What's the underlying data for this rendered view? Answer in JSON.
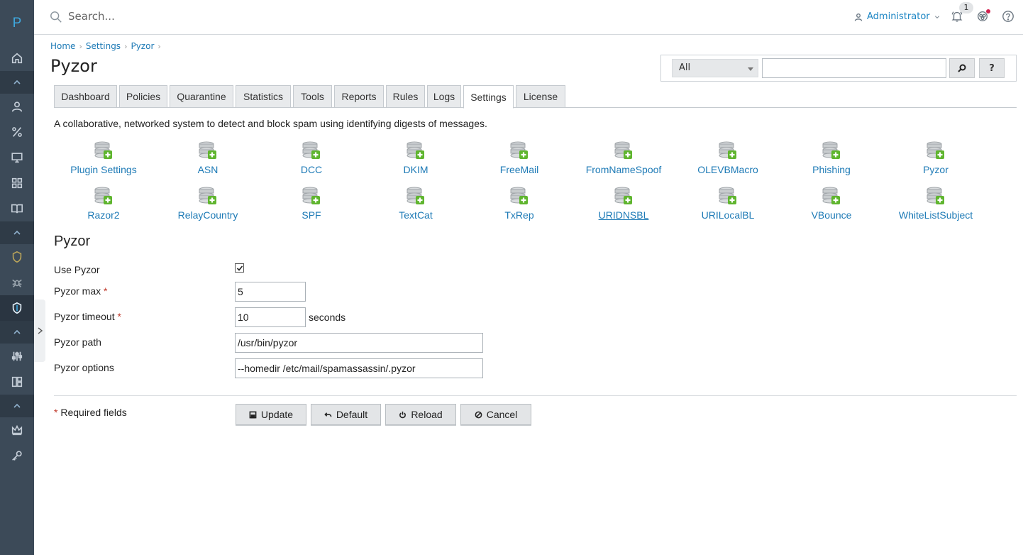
{
  "app": {
    "logo_letter": "P"
  },
  "topbar": {
    "search_placeholder": "Search...",
    "user_name": "Administrator",
    "notification_count": "1"
  },
  "breadcrumb": [
    "Home",
    "Settings",
    "Pyzor"
  ],
  "page_title": "Pyzor",
  "filter": {
    "select_value": "All",
    "search_value": "",
    "help_label": "?"
  },
  "tabs": [
    "Dashboard",
    "Policies",
    "Quarantine",
    "Statistics",
    "Tools",
    "Reports",
    "Rules",
    "Logs",
    "Settings",
    "License"
  ],
  "active_tab": "Settings",
  "description": "A collaborative, networked system to detect and block spam using identifying digests of messages.",
  "plugins": [
    "Plugin Settings",
    "ASN",
    "DCC",
    "DKIM",
    "FreeMail",
    "FromNameSpoof",
    "OLEVBMacro",
    "Phishing",
    "Pyzor",
    "Razor2",
    "RelayCountry",
    "SPF",
    "TextCat",
    "TxRep",
    "URIDNSBL",
    "URILocalBL",
    "VBounce",
    "WhiteListSubject"
  ],
  "section_title": "Pyzor",
  "form": {
    "use_pyzor_label": "Use Pyzor",
    "use_pyzor_checked": true,
    "max_label": "Pyzor max",
    "max_value": "5",
    "timeout_label": "Pyzor timeout",
    "timeout_value": "10",
    "timeout_unit": "seconds",
    "path_label": "Pyzor path",
    "path_value": "/usr/bin/pyzor",
    "options_label": "Pyzor options",
    "options_value": "--homedir /etc/mail/spamassassin/.pyzor",
    "required_marker": "*",
    "required_note": "Required fields"
  },
  "buttons": {
    "update": "Update",
    "default": "Default",
    "reload": "Reload",
    "cancel": "Cancel"
  }
}
